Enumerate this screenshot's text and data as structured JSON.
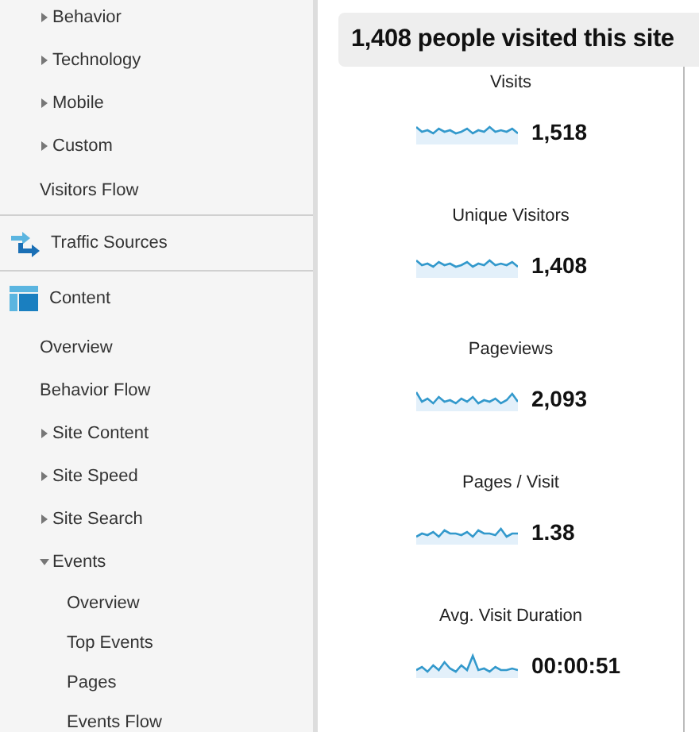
{
  "sidebar": {
    "sections": [
      {
        "items": [
          {
            "label": "Behavior",
            "kind": "group",
            "expanded": false
          },
          {
            "label": "Technology",
            "kind": "group",
            "expanded": false
          },
          {
            "label": "Mobile",
            "kind": "group",
            "expanded": false
          },
          {
            "label": "Custom",
            "kind": "group",
            "expanded": false
          },
          {
            "label": "Visitors Flow",
            "kind": "leaf"
          }
        ]
      },
      {
        "title": "Traffic Sources"
      },
      {
        "title": "Content",
        "items": [
          {
            "label": "Overview",
            "kind": "leaf"
          },
          {
            "label": "Behavior Flow",
            "kind": "leaf"
          },
          {
            "label": "Site Content",
            "kind": "group",
            "expanded": false
          },
          {
            "label": "Site Speed",
            "kind": "group",
            "expanded": false
          },
          {
            "label": "Site Search",
            "kind": "group",
            "expanded": false
          },
          {
            "label": "Events",
            "kind": "group",
            "expanded": true,
            "children": [
              {
                "label": "Overview",
                "kind": "leaf"
              },
              {
                "label": "Top Events",
                "kind": "leaf"
              },
              {
                "label": "Pages",
                "kind": "leaf"
              },
              {
                "label": "Events Flow",
                "kind": "leaf"
              }
            ]
          }
        ]
      }
    ]
  },
  "summary": {
    "title": "1,408 people visited this site",
    "metrics": [
      {
        "label": "Visits",
        "value": "1,518"
      },
      {
        "label": "Unique Visitors",
        "value": "1,408"
      },
      {
        "label": "Pageviews",
        "value": "2,093"
      },
      {
        "label": "Pages / Visit",
        "value": "1.38"
      },
      {
        "label": "Avg. Visit Duration",
        "value": "00:00:51"
      }
    ]
  }
}
